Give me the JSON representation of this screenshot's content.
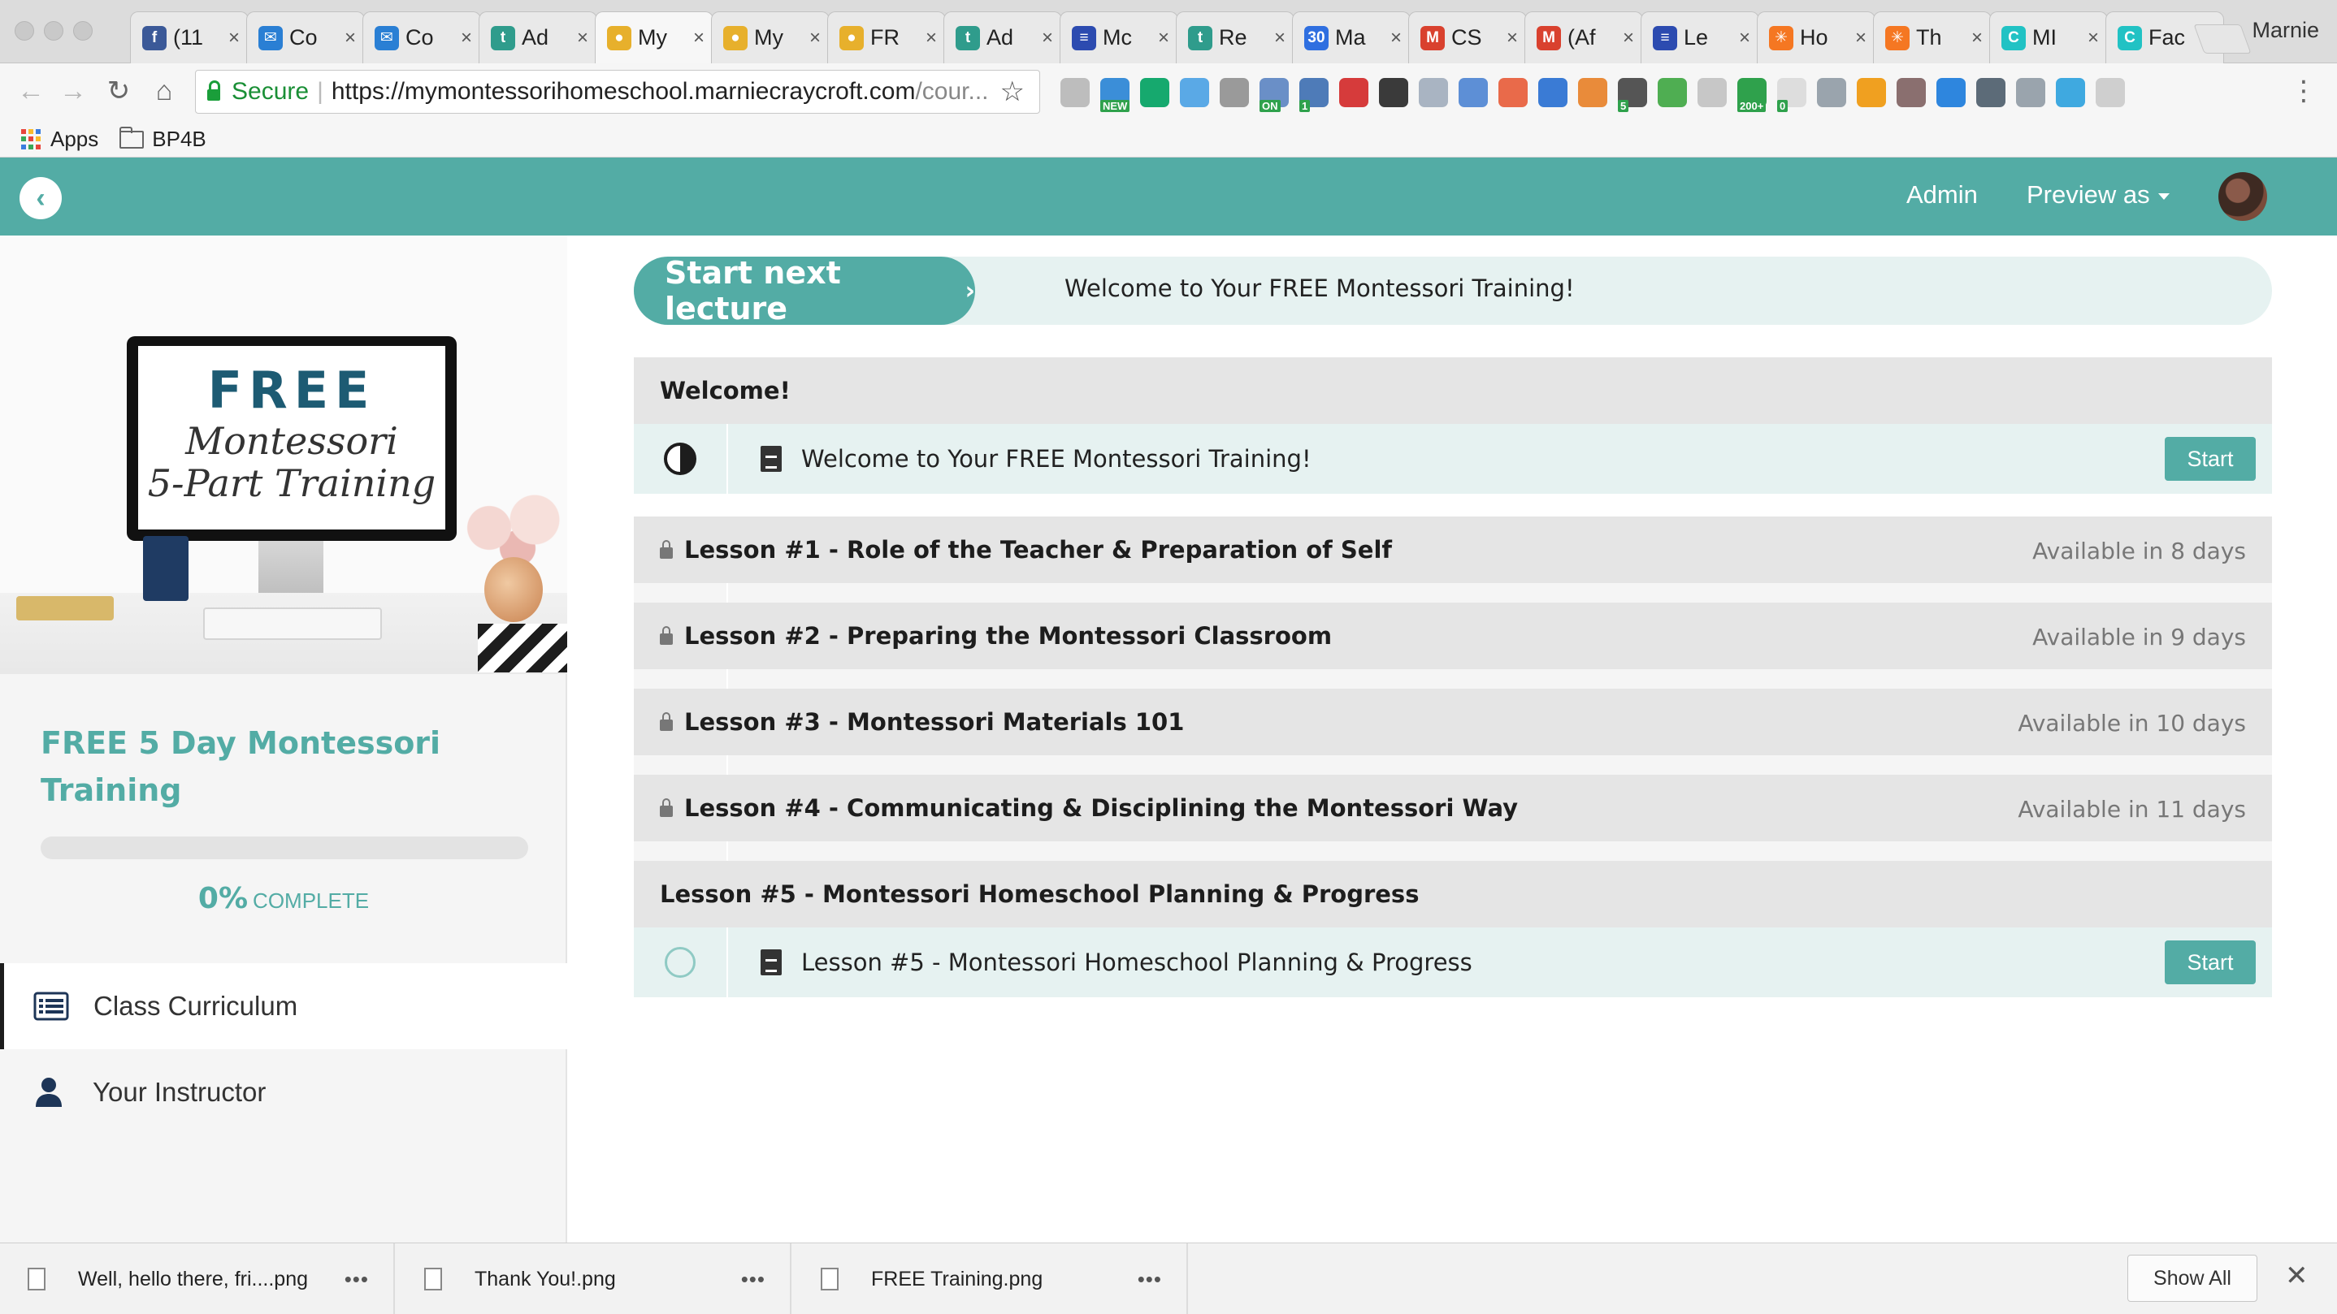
{
  "browser": {
    "profile_name": "Marnie",
    "tabs": [
      {
        "title": "(11",
        "icon": "facebook-icon",
        "color": "#3b5998",
        "glyph": "f"
      },
      {
        "title": "Co",
        "icon": "mail-icon",
        "color": "#2a7fd4",
        "glyph": "✉"
      },
      {
        "title": "Co",
        "icon": "mail-icon",
        "color": "#2a7fd4",
        "glyph": "✉"
      },
      {
        "title": "Ad",
        "icon": "teachable-icon",
        "color": "#2f9c8c",
        "glyph": "t"
      },
      {
        "title": "My",
        "icon": "course-icon",
        "color": "#e7b02c",
        "glyph": "●"
      },
      {
        "title": "My",
        "icon": "course-icon",
        "color": "#e7b02c",
        "glyph": "●"
      },
      {
        "title": "FR",
        "icon": "course-icon",
        "color": "#e7b02c",
        "glyph": "●"
      },
      {
        "title": "Ad",
        "icon": "teachable-icon",
        "color": "#2f9c8c",
        "glyph": "t"
      },
      {
        "title": "Mc",
        "icon": "buffer-icon",
        "color": "#2c4bb0",
        "glyph": "≡"
      },
      {
        "title": "Re",
        "icon": "teachable-icon",
        "color": "#2f9c8c",
        "glyph": "t"
      },
      {
        "title": "Ma",
        "icon": "calendar-icon",
        "color": "#2f6fe0",
        "glyph": "30"
      },
      {
        "title": "CS",
        "icon": "gmail-icon",
        "color": "#d9412e",
        "glyph": "M"
      },
      {
        "title": "(Af",
        "icon": "gmail-icon",
        "color": "#d9412e",
        "glyph": "M"
      },
      {
        "title": "Le",
        "icon": "buffer-icon",
        "color": "#2c4bb0",
        "glyph": "≡"
      },
      {
        "title": "Ho",
        "icon": "hubspot-icon",
        "color": "#f57722",
        "glyph": "✳"
      },
      {
        "title": "Th",
        "icon": "hubspot-icon",
        "color": "#f57722",
        "glyph": "✳"
      },
      {
        "title": "MI",
        "icon": "canva-icon",
        "color": "#21c2c4",
        "glyph": "C"
      },
      {
        "title": "Fac",
        "icon": "canva-icon",
        "color": "#21c2c4",
        "glyph": "C"
      }
    ],
    "omnibox": {
      "secure_label": "Secure",
      "url_main": "https://mymontessorihomeschool.marniecraycroft.com",
      "url_rest": "/cour..."
    },
    "bookmarks": {
      "apps_label": "Apps",
      "folder_label": "BP4B"
    },
    "extensions": [
      {
        "icon": "cloud-icon",
        "color": "#bdbdbd",
        "badge": ""
      },
      {
        "icon": "news-icon",
        "color": "#3b8ed8",
        "badge": "NEW"
      },
      {
        "icon": "grammarly-icon",
        "color": "#16a96e",
        "badge": ""
      },
      {
        "icon": "feather-icon",
        "color": "#5aa9e6",
        "badge": ""
      },
      {
        "icon": "gear-icon",
        "color": "#9a9a9a",
        "badge": ""
      },
      {
        "icon": "calendar-on-icon",
        "color": "#6a8fc7",
        "badge": "ON"
      },
      {
        "icon": "notification-icon",
        "color": "#4e7bb8",
        "badge": "1"
      },
      {
        "icon": "pinterest-icon",
        "color": "#d63b3b",
        "badge": ""
      },
      {
        "icon": "layers-icon",
        "color": "#3a3a3a",
        "badge": ""
      },
      {
        "icon": "code-icon",
        "color": "#a9b4c2",
        "badge": ""
      },
      {
        "icon": "document-icon",
        "color": "#5d8fd6",
        "badge": ""
      },
      {
        "icon": "check-icon",
        "color": "#e96a4a",
        "badge": ""
      },
      {
        "icon": "bookmark-icon",
        "color": "#3a7bd5",
        "badge": ""
      },
      {
        "icon": "bitly-icon",
        "color": "#e98b3a",
        "badge": ""
      },
      {
        "icon": "tag-icon",
        "color": "#555555",
        "badge": "5"
      },
      {
        "icon": "printer-icon",
        "color": "#4fae52",
        "badge": ""
      },
      {
        "icon": "mail-icon",
        "color": "#c7c7c7",
        "badge": ""
      },
      {
        "icon": "count-icon",
        "color": "#2fa14c",
        "badge": "200+"
      },
      {
        "icon": "zero-icon",
        "color": "#dddddd",
        "badge": "0"
      },
      {
        "icon": "linkedin-icon",
        "color": "#9aa4ad",
        "badge": ""
      },
      {
        "icon": "star-icon",
        "color": "#f0a020",
        "badge": ""
      },
      {
        "icon": "k-icon",
        "color": "#8a6f6f",
        "badge": ""
      },
      {
        "icon": "share-icon",
        "color": "#2e86de",
        "badge": ""
      },
      {
        "icon": "clipboard-icon",
        "color": "#5c6b78",
        "badge": ""
      },
      {
        "icon": "facebook-icon",
        "color": "#9aa4ad",
        "badge": ""
      },
      {
        "icon": "rainbow-icon",
        "color": "#3fa9e0",
        "badge": ""
      },
      {
        "icon": "puzzle-icon",
        "color": "#cfcfcf",
        "badge": ""
      }
    ]
  },
  "site": {
    "admin_label": "Admin",
    "preview_label": "Preview as",
    "accent": "#53aca5"
  },
  "sidebar": {
    "art": {
      "headline": "FREE",
      "script_line1": "Montessori",
      "script_line2": "5-Part Training"
    },
    "course_title": "FREE 5 Day Montessori Training",
    "progress_value": 0,
    "progress_pct": "0%",
    "progress_label": "COMPLETE",
    "nav": [
      {
        "label": "Class Curriculum",
        "icon": "list-icon",
        "active": true
      },
      {
        "label": "Your Instructor",
        "icon": "person-icon",
        "active": false
      }
    ]
  },
  "main": {
    "next_button_label": "Start next lecture",
    "next_lecture_title": "Welcome to Your FREE Montessori Training!",
    "sections": [
      {
        "title": "Welcome!",
        "locked": false,
        "availability": "",
        "lecture": "Welcome to Your FREE Montessori Training!",
        "status": "in-progress",
        "button": "Start"
      },
      {
        "title": "Lesson #1 - Role of the Teacher & Preparation of Self",
        "locked": true,
        "availability": "Available in 8 days",
        "lecture": "Lesson #1 - Role of the Teacher & Preparation of Self",
        "status": "locked",
        "button": ""
      },
      {
        "title": "Lesson #2 - Preparing the Montessori Classroom",
        "locked": true,
        "availability": "Available in 9 days",
        "lecture": "Lesson #2 - Preparing the Montessori Classroom",
        "status": "locked",
        "button": ""
      },
      {
        "title": "Lesson #3 - Montessori Materials 101",
        "locked": true,
        "availability": "Available in 10 days",
        "lecture": "Lesson #3 - Montessori Materials 101",
        "status": "locked",
        "button": ""
      },
      {
        "title": "Lesson #4 - Communicating & Disciplining the Montessori Way",
        "locked": true,
        "availability": "Available in 11 days",
        "lecture": "Lesson #4 - Communicating & Disciplining the Montessori Way",
        "status": "locked",
        "button": ""
      },
      {
        "title": "Lesson #5 - Montessori Homeschool Planning & Progress",
        "locked": false,
        "availability": "",
        "lecture": "Lesson #5 - Montessori Homeschool Planning & Progress",
        "status": "open",
        "button": "Start"
      }
    ]
  },
  "downloads": {
    "items": [
      {
        "name": "Well, hello there, fri....png"
      },
      {
        "name": "Thank You!.png"
      },
      {
        "name": "FREE Training.png"
      }
    ],
    "show_all_label": "Show All"
  }
}
